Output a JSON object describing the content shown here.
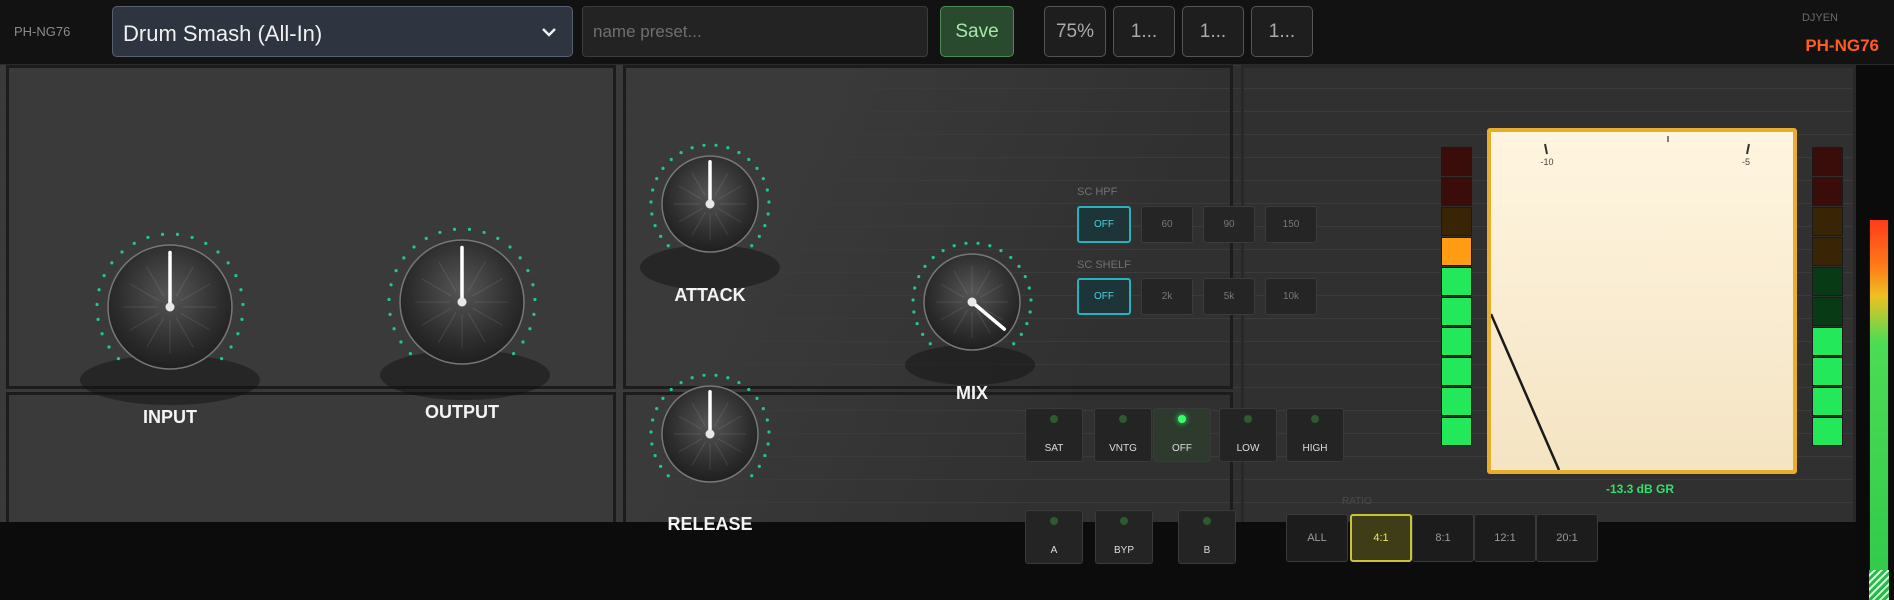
{
  "header": {
    "plugin_id": "PH-NG76",
    "preset_name": "Drum Smash (All-In)",
    "name_placeholder": "name preset...",
    "save_label": "Save",
    "zoom_label": "75%",
    "extra_buttons": [
      "1...",
      "1...",
      "1..."
    ],
    "vendor": "DJYEN",
    "brand": "PH-NG76"
  },
  "knobs": {
    "input": {
      "label": "INPUT"
    },
    "output": {
      "label": "OUTPUT"
    },
    "attack": {
      "label": "ATTACK"
    },
    "release": {
      "label": "RELEASE"
    },
    "mix": {
      "label": "MIX"
    }
  },
  "sidechain": {
    "hpf_label": "SC HPF",
    "hpf_options": [
      "OFF",
      "60",
      "90",
      "150"
    ],
    "hpf_selected": "OFF",
    "shelf_label": "SC SHELF",
    "shelf_options": [
      "OFF",
      "2k",
      "5k",
      "10k"
    ],
    "shelf_selected": "OFF"
  },
  "modes": [
    {
      "label": "SAT",
      "on": false
    },
    {
      "label": "VNTG",
      "on": false
    },
    {
      "label": "OFF",
      "on": true
    },
    {
      "label": "LOW",
      "on": false
    },
    {
      "label": "HIGH",
      "on": false
    }
  ],
  "ab": [
    {
      "label": "A"
    },
    {
      "label": "BYP"
    },
    {
      "label": "B"
    }
  ],
  "ratio": {
    "label": "RATIO",
    "options": [
      "ALL",
      "4:1",
      "8:1",
      "12:1",
      "20:1"
    ],
    "selected": "4:1"
  },
  "meter": {
    "scale_labels": [
      "-10",
      "-5"
    ],
    "gr_readout": "-13.3 dB GR"
  },
  "colors": {
    "accent": "#27b3bd",
    "brand": "#ff5c22",
    "meter_green": "#30e06a",
    "ratio_active": "#c8c33a"
  }
}
